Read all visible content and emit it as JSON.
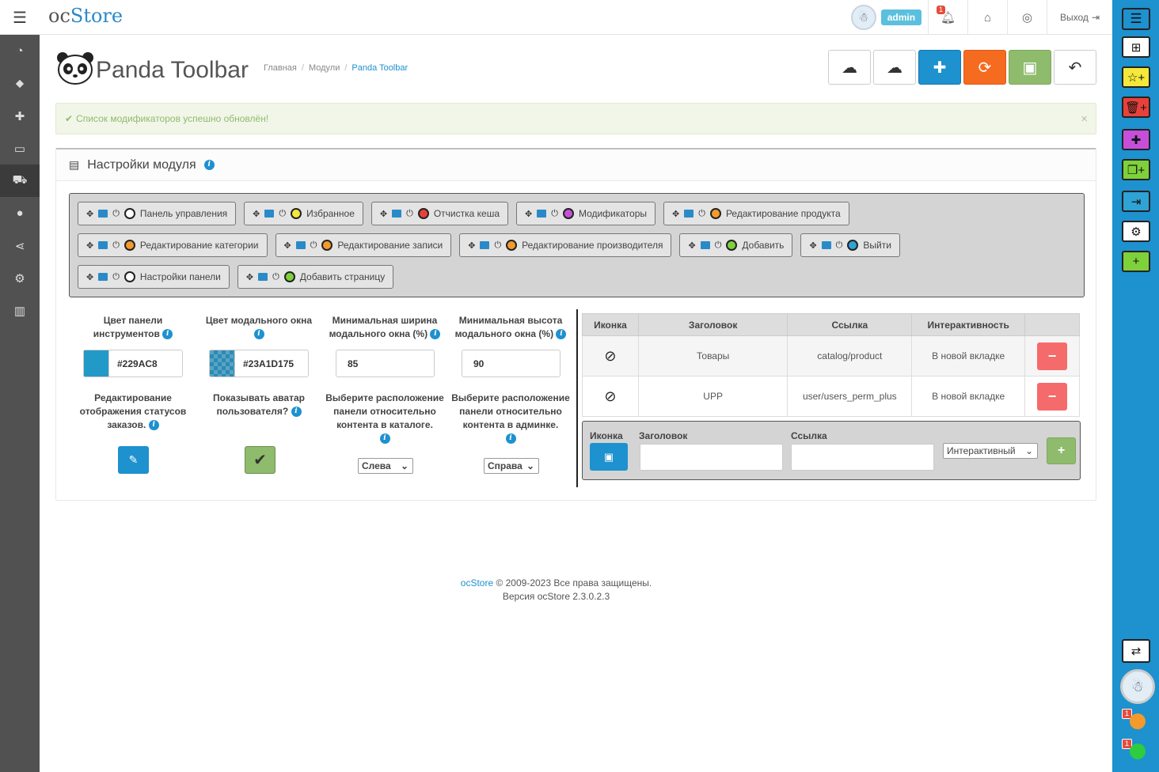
{
  "header": {
    "logo_prefix": "oc",
    "logo_suffix": "Store",
    "user_name": "admin",
    "notification_count": "1",
    "logout_label": "Выход"
  },
  "sidebar": {
    "items": [
      "dashboard-icon",
      "tags-icon",
      "puzzle-icon",
      "monitor-icon",
      "cart-icon",
      "user-icon",
      "share-icon",
      "gear-icon",
      "chart-icon"
    ]
  },
  "page": {
    "title": "Panda Toolbar",
    "breadcrumb": [
      "Главная",
      "Модули",
      "Panda Toolbar"
    ]
  },
  "alert": {
    "text": "Список модификаторов успешно обновлён!",
    "close": "×"
  },
  "panel": {
    "title": "Настройки модуля",
    "toolbar_rows": [
      [
        {
          "label": "Панель управления",
          "color": "#ffffff"
        },
        {
          "label": "Избранное",
          "color": "#f4e83a"
        },
        {
          "label": "Отчистка кеша",
          "color": "#e8413b"
        },
        {
          "label": "Модификаторы",
          "color": "#c64fd9"
        },
        {
          "label": "Редактирование продукта",
          "color": "#f39a2b"
        }
      ],
      [
        {
          "label": "Редактирование категории",
          "color": "#f39a2b"
        },
        {
          "label": "Редактирование записи",
          "color": "#f39a2b"
        },
        {
          "label": "Редактирование производителя",
          "color": "#f39a2b"
        },
        {
          "label": "Добавить",
          "color": "#7ed13a"
        },
        {
          "label": "Выйти",
          "color": "#2fa3d6"
        }
      ],
      [
        {
          "label": "Настройки панели",
          "color": "#ffffff"
        },
        {
          "label": "Добавить страницу",
          "color": "#7ed13a"
        }
      ]
    ]
  },
  "settings": {
    "toolbar_color_label": "Цвет панели инструментов",
    "toolbar_color_value": "#229AC8",
    "toolbar_color_hex": "#229ac8",
    "modal_color_label": "Цвет модального окна",
    "modal_color_value": "#23A1D175",
    "min_width_label": "Минимальная ширина модального окна (%)",
    "min_width_value": "85",
    "min_height_label": "Минимальная высота модального окна (%)",
    "min_height_value": "90",
    "order_status_label": "Редактирование отображения статусов заказов.",
    "show_avatar_label": "Показывать аватар пользователя?",
    "catalog_pos_label": "Выберите расположение панели относительно контента в каталоге.",
    "catalog_pos_value": "Слева",
    "admin_pos_label": "Выберите расположение панели относительно контента в админке.",
    "admin_pos_value": "Справа"
  },
  "link_table": {
    "headers": [
      "Иконка",
      "Заголовок",
      "Ссылка",
      "Интерактивность",
      ""
    ],
    "rows": [
      {
        "title": "Товары",
        "link": "catalog/product",
        "mode": "В новой вкладке"
      },
      {
        "title": "UPP",
        "link": "user/users_perm_plus",
        "mode": "В новой вкладке"
      }
    ],
    "delete_label": "−"
  },
  "add_form": {
    "icon_label": "Иконка",
    "title_label": "Заголовок",
    "link_label": "Ссылка",
    "mode_value": "Интерактивный",
    "add_label": "+"
  },
  "footer": {
    "link": "ocStore",
    "copyright": " © 2009-2023 Все права защищены.",
    "version": "Версия ocStore 2.3.0.2.3"
  },
  "rightbar": {
    "notif_count_1": "1",
    "notif_count_2": "1"
  },
  "colors": {
    "accent": "#1e91cf",
    "success": "#8fbb6c",
    "danger": "#f56b6b",
    "warning": "#f56b1f"
  }
}
